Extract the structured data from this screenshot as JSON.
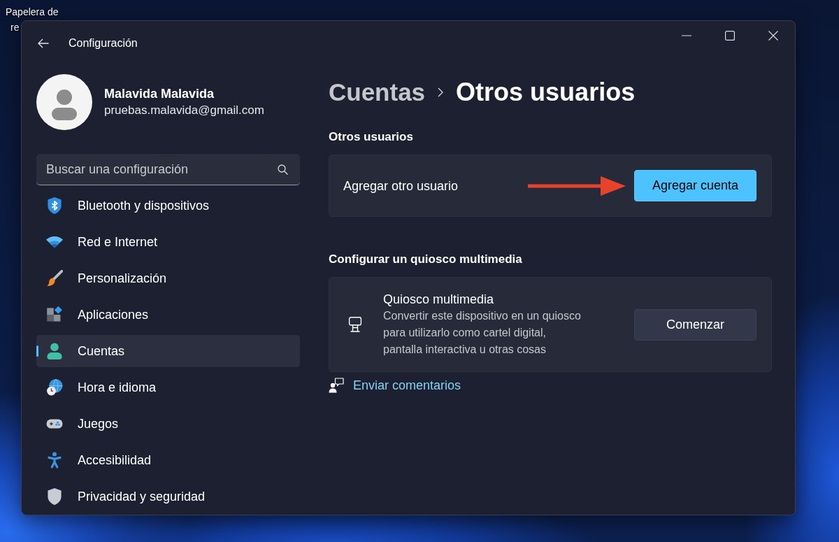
{
  "desktop": {
    "icon_label_lines": [
      "Papelera de",
      "re"
    ]
  },
  "window": {
    "title": "Configuración"
  },
  "profile": {
    "name": "Malavida Malavida",
    "email": "pruebas.malavida@gmail.com"
  },
  "search": {
    "placeholder": "Buscar una configuración"
  },
  "sidebar": {
    "items": [
      {
        "label": "Bluetooth y dispositivos",
        "selected": false
      },
      {
        "label": "Red e Internet",
        "selected": false
      },
      {
        "label": "Personalización",
        "selected": false
      },
      {
        "label": "Aplicaciones",
        "selected": false
      },
      {
        "label": "Cuentas",
        "selected": true
      },
      {
        "label": "Hora e idioma",
        "selected": false
      },
      {
        "label": "Juegos",
        "selected": false
      },
      {
        "label": "Accesibilidad",
        "selected": false
      },
      {
        "label": "Privacidad y seguridad",
        "selected": false
      }
    ]
  },
  "breadcrumb": {
    "parent": "Cuentas",
    "current": "Otros usuarios"
  },
  "sections": [
    {
      "heading": "Otros usuarios",
      "cards": [
        {
          "title": "Agregar otro usuario",
          "button": {
            "label": "Agregar cuenta",
            "primary": true
          }
        }
      ]
    },
    {
      "heading": "Configurar un quiosco multimedia",
      "cards": [
        {
          "title": "Quiosco multimedia",
          "description": "Convertir este dispositivo en un quiosco para utilizarlo como cartel digital, pantalla interactiva u otras cosas",
          "button": {
            "label": "Comenzar",
            "primary": false
          }
        }
      ]
    }
  ],
  "feedback": {
    "link": "Enviar comentarios"
  }
}
